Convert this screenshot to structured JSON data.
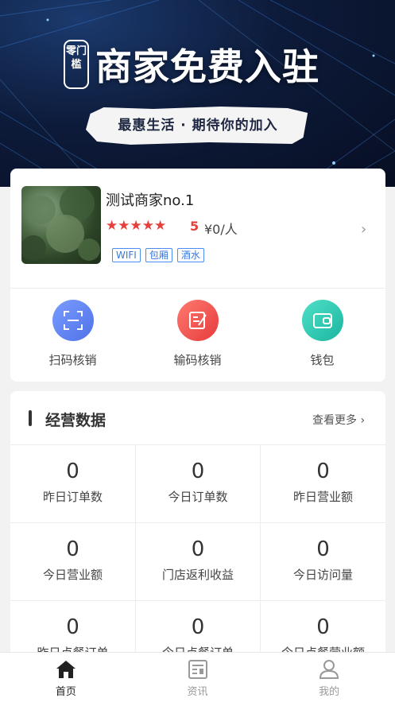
{
  "banner": {
    "brand": "零门槛",
    "title": "商家免费入驻",
    "slogan": "最惠生活 · 期待你的加入"
  },
  "shop": {
    "name": "测试商家no.1",
    "stars": "★★★★★",
    "score": "5",
    "price": "¥0/人",
    "tags": [
      "WIFI",
      "包厢",
      "酒水"
    ]
  },
  "actions": [
    {
      "label": "扫码核销",
      "icon": "scan-icon",
      "color": "#5a7ff0"
    },
    {
      "label": "输码核销",
      "icon": "edit-code-icon",
      "color": "#ef5350"
    },
    {
      "label": "钱包",
      "icon": "wallet-icon",
      "color": "#26c6b2"
    }
  ],
  "stats": {
    "title": "经营数据",
    "more": "查看更多",
    "items": [
      {
        "value": "0",
        "label": "昨日订单数"
      },
      {
        "value": "0",
        "label": "今日订单数"
      },
      {
        "value": "0",
        "label": "昨日营业额"
      },
      {
        "value": "0",
        "label": "今日营业额"
      },
      {
        "value": "0",
        "label": "门店返利收益"
      },
      {
        "value": "0",
        "label": "今日访问量"
      },
      {
        "value": "0",
        "label": "昨日点餐订单"
      },
      {
        "value": "0",
        "label": "今日点餐订单"
      },
      {
        "value": "0",
        "label": "今日点餐营业额"
      }
    ]
  },
  "tabbar": {
    "items": [
      {
        "label": "首页",
        "icon": "home-icon",
        "active": true
      },
      {
        "label": "资讯",
        "icon": "news-icon",
        "active": false
      },
      {
        "label": "我的",
        "icon": "user-icon",
        "active": false
      }
    ],
    "active_color": "#222222",
    "inactive_color": "#999999"
  }
}
